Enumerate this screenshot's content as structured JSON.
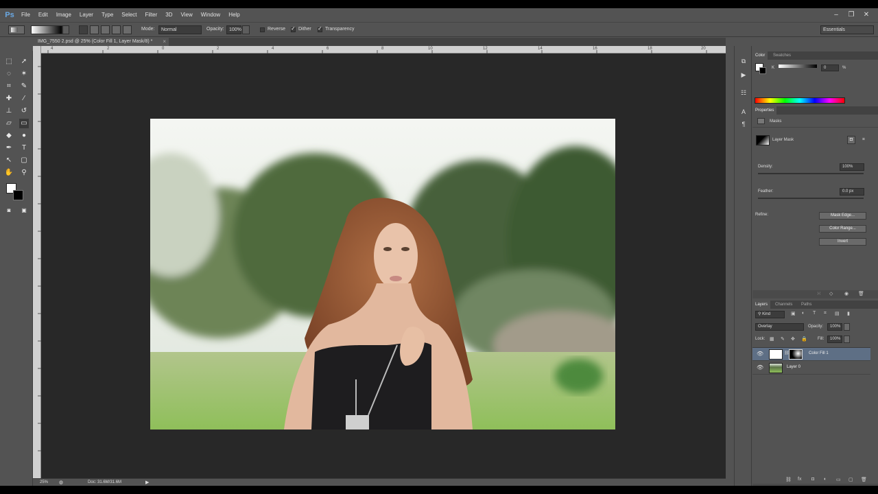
{
  "app": {
    "logo": "Ps",
    "menu": [
      "File",
      "Edit",
      "Image",
      "Layer",
      "Type",
      "Select",
      "Filter",
      "3D",
      "View",
      "Window",
      "Help"
    ],
    "window_controls": [
      "–",
      "❐",
      "✕"
    ]
  },
  "options_bar": {
    "mode_label": "Mode:",
    "mode_value": "Normal",
    "opacity_label": "Opacity:",
    "opacity_value": "100%",
    "reverse_label": "Reverse",
    "reverse_checked": false,
    "dither_label": "Dither",
    "dither_checked": true,
    "transparency_label": "Transparency",
    "transparency_checked": true,
    "workspace": "Essentials"
  },
  "document": {
    "tab_title": "IMG_7550 2.psd @ 25% (Color Fill 1, Layer Mask/8) *",
    "tab_close": "×"
  },
  "ruler": {
    "top_ticks": [
      "4",
      "2",
      "0",
      "2",
      "4",
      "6",
      "8",
      "10",
      "12",
      "14",
      "16",
      "18",
      "20"
    ]
  },
  "status_bar": {
    "zoom": "25%",
    "doc_info": "Doc: 31.6M/31.6M"
  },
  "color_panel": {
    "tabs": [
      "Color",
      "Swatches"
    ],
    "channel_label": "K",
    "channel_value": "0",
    "unit": "%"
  },
  "properties_panel": {
    "tab": "Properties",
    "section": "Masks",
    "mask_type": "Layer Mask",
    "density_label": "Density:",
    "density_value": "100%",
    "feather_label": "Feather:",
    "feather_value": "0.0 px",
    "refine_label": "Refine:",
    "buttons": [
      "Mask Edge...",
      "Color Range...",
      "Invert"
    ]
  },
  "layers_panel": {
    "tabs": [
      "Layers",
      "Channels",
      "Paths"
    ],
    "filter_kind": "Kind",
    "blend_mode": "Overlay",
    "opacity_label": "Opacity:",
    "opacity_value": "100%",
    "lock_label": "Lock:",
    "fill_label": "Fill:",
    "fill_value": "100%",
    "layers": [
      {
        "name": "Color Fill 1",
        "selected": true
      },
      {
        "name": "Layer 0",
        "selected": false
      }
    ]
  },
  "colors": {
    "ui_bg": "#535353",
    "canvas_bg": "#282828",
    "selection": "#5e6f85"
  }
}
